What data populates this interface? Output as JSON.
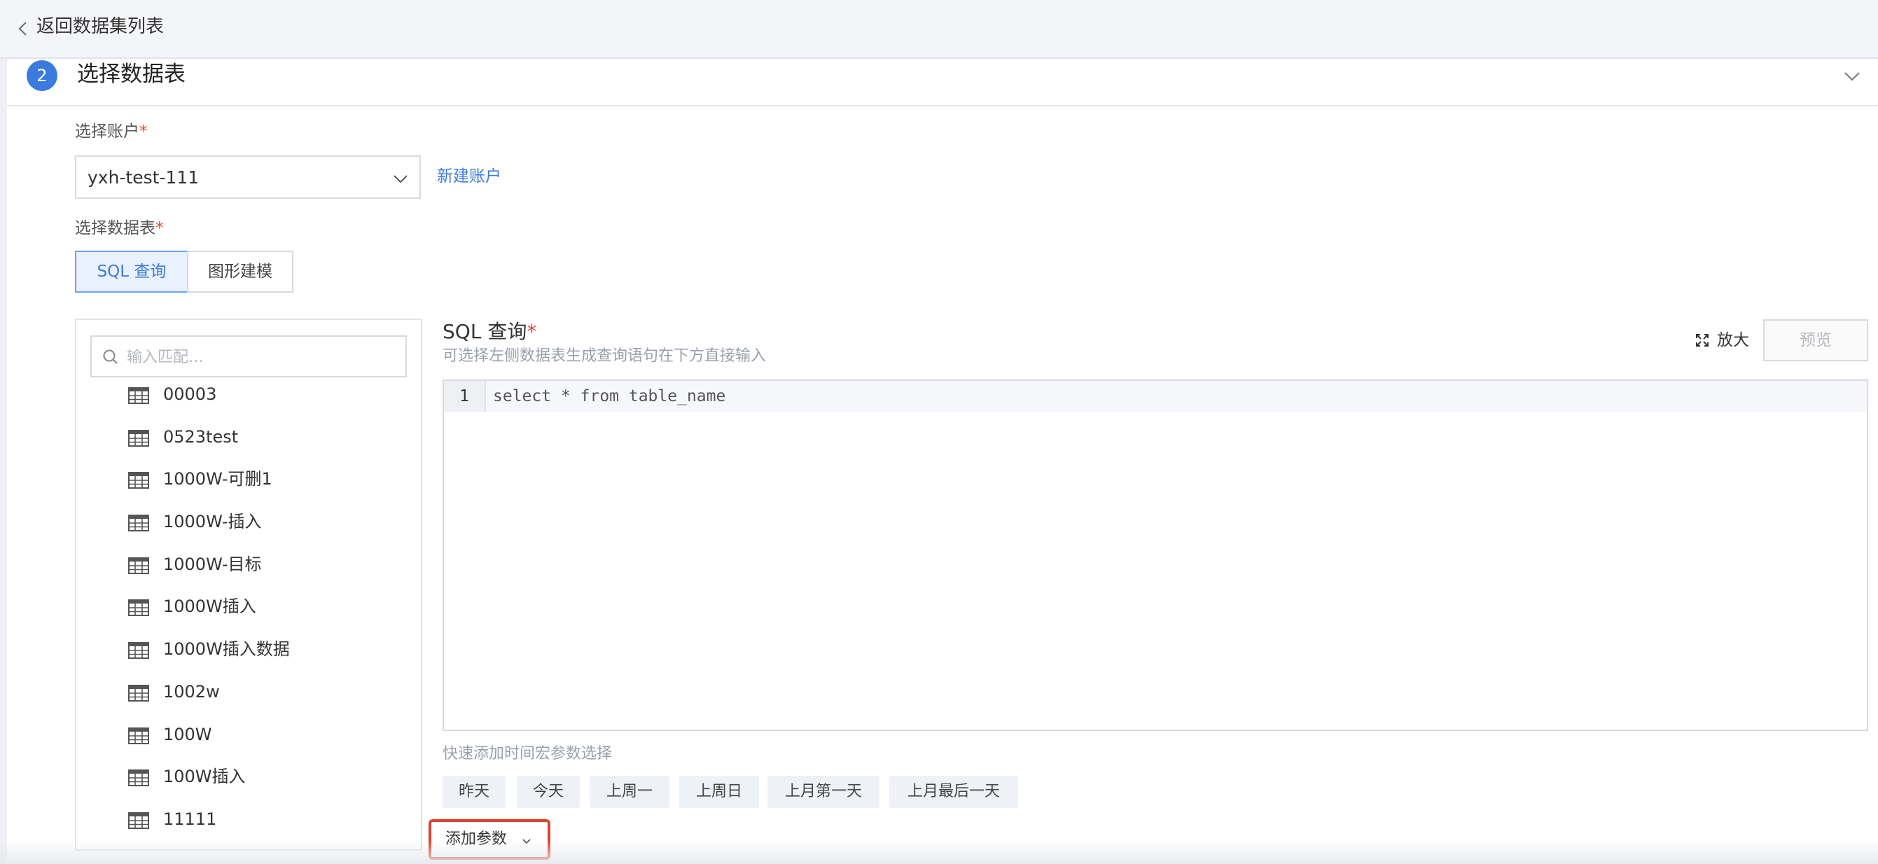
{
  "topbar": {
    "back_label": "返回数据集列表"
  },
  "section": {
    "step_number": "2",
    "title": "选择数据表"
  },
  "account": {
    "label": "选择账户",
    "required_mark": "*",
    "selected": "yxh-test-111",
    "new_account_link": "新建账户"
  },
  "table_select": {
    "label": "选择数据表",
    "required_mark": "*",
    "modes": [
      "SQL 查询",
      "图形建模"
    ],
    "active_mode": "SQL 查询"
  },
  "table_panel": {
    "search_placeholder": "输入匹配…",
    "tables": [
      "00003",
      "0523test",
      "1000W-可删1",
      "1000W-插入",
      "1000W-目标",
      "1000W插入",
      "1000W插入数据",
      "1002w",
      "100W",
      "100W插入",
      "11111"
    ]
  },
  "sql": {
    "title": "SQL 查询",
    "required_mark": "*",
    "hint": "可选择左侧数据表生成查询语句在下方直接输入",
    "zoom_label": "放大",
    "preview_label": "预览",
    "line_number": "1",
    "code": "select * from table_name"
  },
  "macros": {
    "label": "快速添加时间宏参数选择",
    "items": [
      "昨天",
      "今天",
      "上周一",
      "上周日",
      "上月第一天",
      "上月最后一天"
    ]
  },
  "add_param": {
    "label": "添加参数"
  },
  "colors": {
    "accent": "#3b7be0",
    "required": "#e04b3a",
    "highlight_border": "#e0402d"
  }
}
